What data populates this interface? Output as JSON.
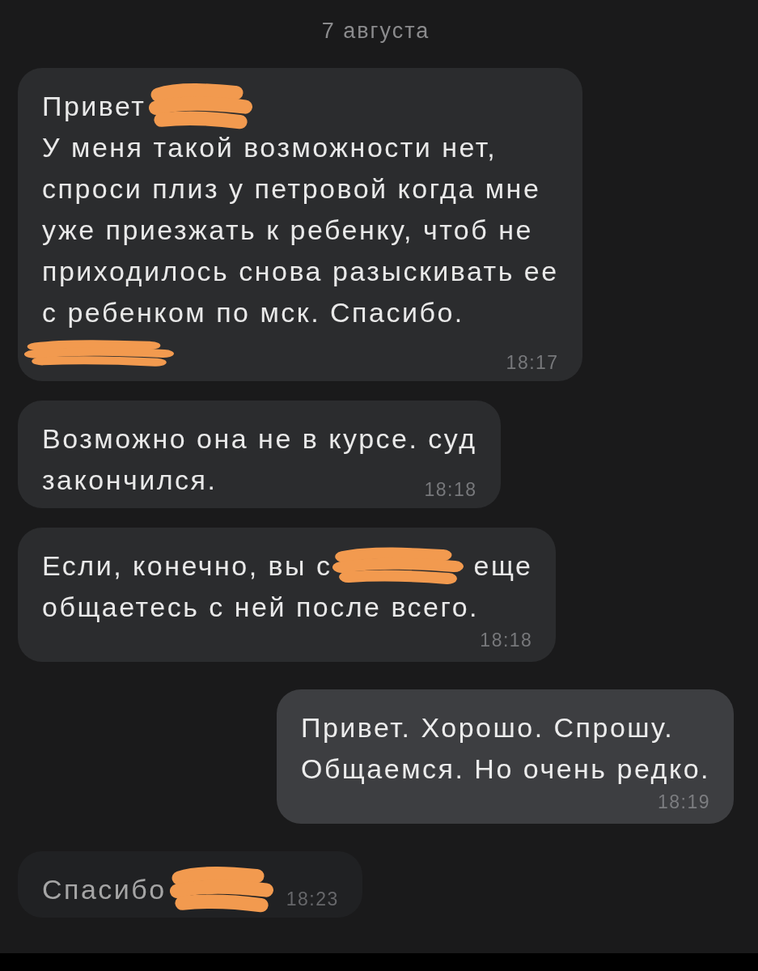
{
  "date_separator": {
    "text": "7 августа"
  },
  "messages": [
    {
      "kind": "incoming",
      "dimmed": false,
      "time_inline": true,
      "time": "18:17",
      "blocks": [
        [
          {
            "kind": "text",
            "text": "Привет"
          },
          {
            "kind": "redacted"
          }
        ],
        [
          {
            "kind": "text",
            "text": "У меня такой возможности нет,\nспроси плиз у петровой когда мне\nуже приезжать к ребенку, чтоб не\nприходилось снова разыскивать ее\nс ребенком по мск. Спасибо."
          }
        ],
        [
          {
            "kind": "redacted"
          }
        ]
      ]
    },
    {
      "kind": "incoming",
      "dimmed": false,
      "time_inline": true,
      "time": "18:18",
      "blocks": [
        [
          {
            "kind": "text",
            "text": "Возможно она не в курсе. суд"
          }
        ],
        [
          {
            "kind": "text",
            "text": "закончился."
          }
        ]
      ]
    },
    {
      "kind": "incoming",
      "dimmed": false,
      "time_inline": false,
      "time": "18:18",
      "blocks": [
        [
          {
            "kind": "text",
            "text": "Если, конечно, вы с"
          },
          {
            "kind": "redacted"
          },
          {
            "kind": "text",
            "text": "еще"
          }
        ],
        [
          {
            "kind": "text",
            "text": "общаетесь с ней после всего."
          }
        ]
      ]
    },
    {
      "kind": "outgoing",
      "dimmed": false,
      "time_inline": false,
      "time": "18:19",
      "blocks": [
        [
          {
            "kind": "text",
            "text": "Привет. Хорошо. Спрошу.\nОбщаемся. Но очень редко."
          }
        ]
      ]
    },
    {
      "kind": "incoming",
      "dimmed": true,
      "time_inline": true,
      "time": "18:23",
      "blocks": [
        [
          {
            "kind": "text",
            "text": "Спасибо"
          },
          {
            "kind": "redacted"
          }
        ]
      ]
    }
  ]
}
